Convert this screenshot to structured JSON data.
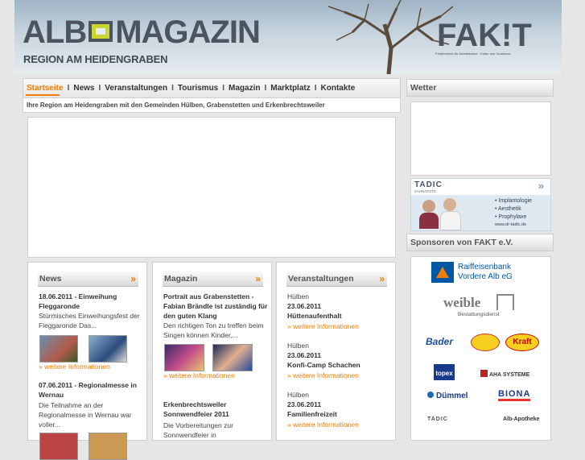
{
  "header": {
    "logo": "ALB",
    "logo_mid": "MAGAZIN",
    "subtitle": "REGION AM HEIDENGRABEN",
    "fakt": "FAK!T",
    "fakt_sub": "Förderverein für Arbeitskreise · Kultur und Tourismus"
  },
  "nav": {
    "items": [
      "Startseite",
      "News",
      "Veranstaltungen",
      "Tourismus",
      "Magazin",
      "Marktplatz",
      "Kontakte"
    ],
    "active": "Startseite",
    "separator": "I"
  },
  "tagline": "Ihre Region am Heidengraben mit den Gemeinden Hülben, Grabenstetten und Erkenbrechtsweiler",
  "right": {
    "wetter_title": "Wetter",
    "sponsors_title": "Sponsoren von FAKT e.V.",
    "tadic_ad": {
      "name": "TADIC",
      "sub": "ZAHNÄRZTE",
      "lines": [
        "• Implantologie",
        "• Aesthetik",
        "• Prophylaxe"
      ],
      "url": "www.dr-tadic.de"
    },
    "sponsors": {
      "raiffeisen": [
        "Raiffeisenbank",
        "Vordere Alb eG"
      ],
      "weible": "weible",
      "weible_sub": "Bestattungsdienst",
      "bader": "Bader",
      "kraft": "Kraft",
      "topex": "topex",
      "aha": "AHA SYSTEME",
      "duemmel": "Dümmel",
      "biona": "BIONA",
      "tadic": "TADIC",
      "alb_apotheke": "Alb-Apotheke"
    }
  },
  "columns": {
    "news": {
      "title": "News",
      "arrow": "»",
      "item1_title": "18.06.2011 - Einweihung Fleggaronde",
      "item1_text": "Stürmisches Einweihungsfest der Fleggaronde Das...",
      "item1_more": "» weitere Informationen",
      "item2_title": "07.06.2011 - Regionalmesse in Wernau",
      "item2_text": "Die Teilnahme an der Regionalmesse in Wernau war voller..."
    },
    "magazin": {
      "title": "Magazin",
      "arrow": "»",
      "item1_title": "Portrait aus Grabenstetten - Fabian Brändle ist zuständig für den guten Klang",
      "item1_text": "Den richtigen Ton zu treffen beim Singen können Kinder,...",
      "item1_more": "» weitere Informationen",
      "item2_title": "Erkenbrechtsweiler Sonnwendfeier 2011",
      "item2_text": "Die Vorbereitungen zur Sonnwendfeier in"
    },
    "veranstaltungen": {
      "title": "Veranstaltungen",
      "arrow": "»",
      "events": [
        {
          "place": "Hülben",
          "date": "23.06.2011",
          "name": "Hüttenaufenthalt",
          "more": "» weitere Informationen"
        },
        {
          "place": "Hülben",
          "date": "23.06.2011",
          "name": "Konfi-Camp Schachen",
          "more": "» weitere Informationen"
        },
        {
          "place": "Hülben",
          "date": "23.06.2011",
          "name": "Familienfreizeit",
          "more": "» weitere Informationen"
        }
      ]
    }
  },
  "colors": {
    "accent": "#f07d00",
    "raiffeisen_blue": "#0057a3",
    "topex_blue": "#1a3a8c"
  }
}
